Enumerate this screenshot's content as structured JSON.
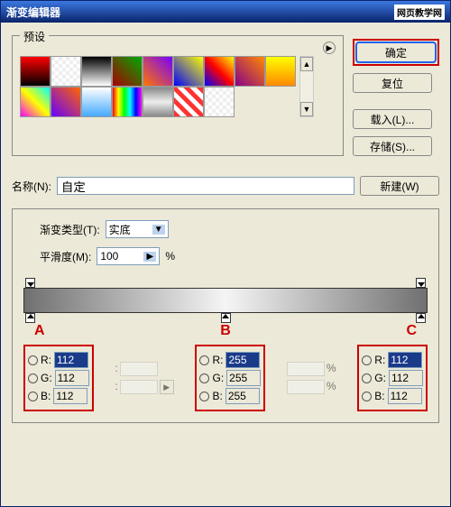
{
  "window": {
    "title": "渐变编辑器",
    "watermark": "网页教学网"
  },
  "presets": {
    "legend": "预设"
  },
  "buttons": {
    "ok": "确定",
    "reset": "复位",
    "load": "载入(L)...",
    "save": "存储(S)...",
    "new": "新建(W)"
  },
  "name": {
    "label": "名称(N):",
    "value": "自定"
  },
  "type": {
    "label": "渐变类型(T):",
    "value": "实底"
  },
  "smooth": {
    "label": "平滑度(M):",
    "value": "100",
    "unit": "%"
  },
  "markers": {
    "a": "A",
    "b": "B",
    "c": "C"
  },
  "rgb": {
    "labels": {
      "r": "R:",
      "g": "G:",
      "b": "B:"
    },
    "a": {
      "r": "112",
      "g": "112",
      "b": "112"
    },
    "b": {
      "r": "255",
      "g": "255",
      "b": "255"
    },
    "c": {
      "r": "112",
      "g": "112",
      "b": "112"
    }
  },
  "extra": {
    "pct": "%"
  }
}
